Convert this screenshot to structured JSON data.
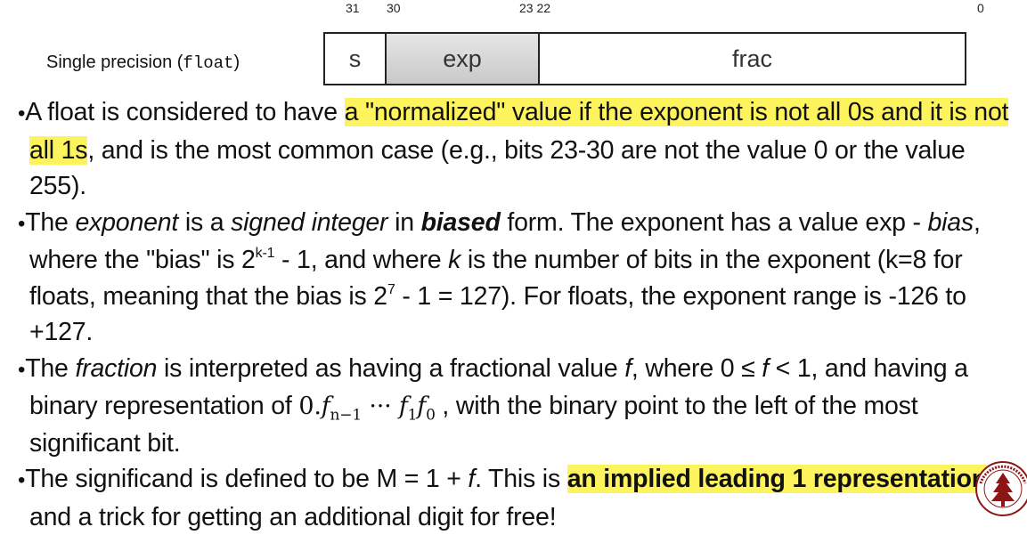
{
  "bit_labels": {
    "b31": "31",
    "b30": "30",
    "b2322": "23 22",
    "b0": "0"
  },
  "format": {
    "label_prefix": "Single precision (",
    "label_code": "float",
    "label_suffix": ")"
  },
  "fields": {
    "s": "s",
    "exp": "exp",
    "frac": "frac"
  },
  "bullets": {
    "b1": {
      "pre": "A float is considered to have ",
      "hl": "a \"normalized\" value if the exponent is not all 0s and it is not all 1s",
      "post": ", and is the most common case (e.g., bits 23-30 are not the value 0 or the value 255)."
    },
    "b2": {
      "t1": "The ",
      "i1": "exponent",
      "t2": " is a ",
      "i2": "signed integer",
      "t3": " in ",
      "bi": "biased",
      "t4": " form. The exponent has a value exp - ",
      "i3": "bias",
      "t5": ", where the \"bias\" is 2",
      "sup1": "k-1",
      "t6": " - 1, and where ",
      "i4": "k",
      "t7": " is the number of bits in the exponent (k=8 for floats, meaning that the bias is 2",
      "sup2": "7",
      "t8": " - 1 = 127). For floats, the exponent range is -126 to +127."
    },
    "b3": {
      "t1": "The ",
      "i1": "fraction",
      "t2": " is interpreted as having a fractional value ",
      "i2": "f",
      "t3": ", where 0 ≤ ",
      "i3": "f",
      "t4": " < 1, and having a binary representation of ",
      "t5": " , with the binary point to the left of the most significant bit."
    },
    "b4": {
      "t1": "The significand is defined to be M = 1 + ",
      "i1": "f",
      "t2": ". This is ",
      "hl": "an implied leading 1 representation",
      "t3": ", and a trick for getting an additional digit for free!"
    }
  },
  "math": {
    "m0": "0.",
    "f": "f",
    "sub_n1": "n−1",
    "dots": " ··· ",
    "sub1": "1",
    "sub0": "0"
  },
  "seal": {
    "text": "STANFORD UNIVERSITY",
    "year": "1891"
  },
  "colors": {
    "highlight": "#fdf35c",
    "exp_fill": "#d4d4d4"
  }
}
